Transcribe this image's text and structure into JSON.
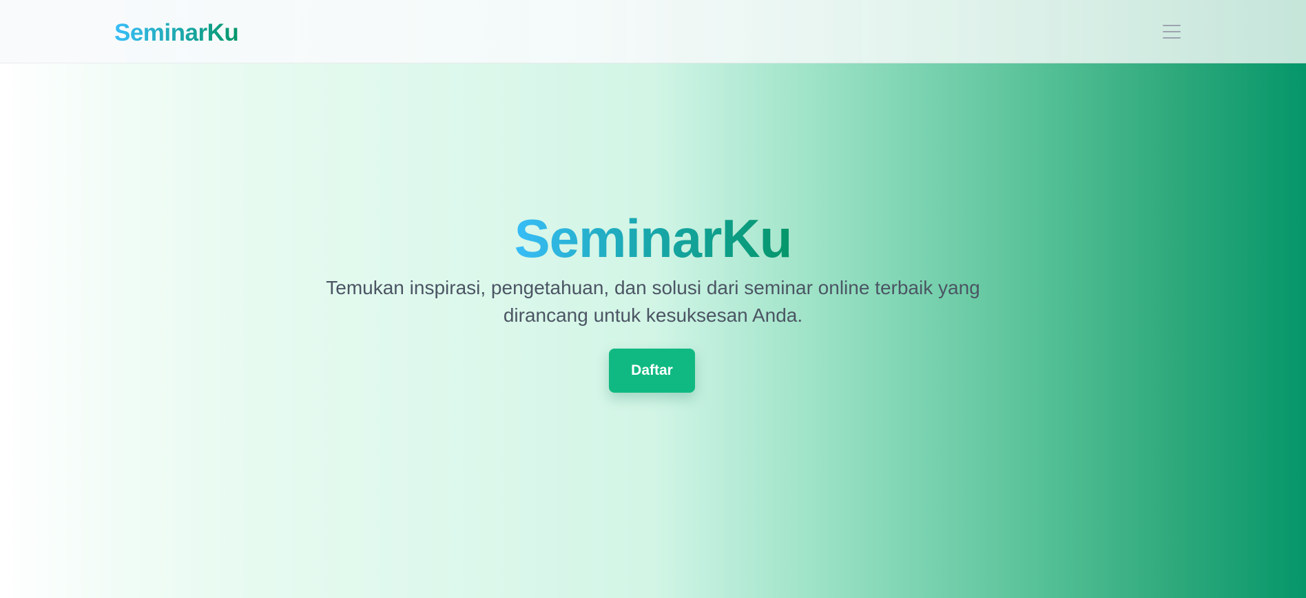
{
  "navbar": {
    "brand": "SeminarKu",
    "menu_icon": "hamburger-menu-icon"
  },
  "hero": {
    "title": "SeminarKu",
    "subtitle": "Temukan inspirasi, pengetahuan, dan solusi dari seminar online terbaik yang dirancang untuk kesuksesan Anda.",
    "cta_label": "Daftar"
  },
  "colors": {
    "brand_gradient_start": "#38bdf8",
    "brand_gradient_end": "#059669",
    "button": "#10b981",
    "subtitle_text": "#4b5563",
    "menu_icon": "#9ca3af"
  }
}
